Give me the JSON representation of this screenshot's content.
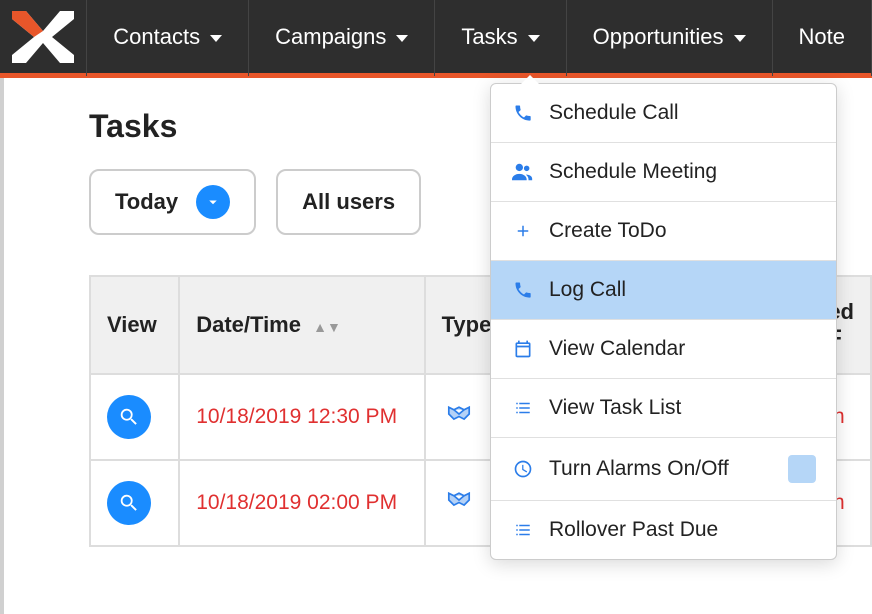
{
  "nav": {
    "contacts": "Contacts",
    "campaigns": "Campaigns",
    "tasks": "Tasks",
    "opportunities": "Opportunities",
    "notes": "Note"
  },
  "page": {
    "title": "Tasks"
  },
  "filters": {
    "today": "Today",
    "all_users": "All users"
  },
  "dropdown": {
    "schedule_call": "Schedule Call",
    "schedule_meeting": "Schedule Meeting",
    "create_todo": "Create ToDo",
    "log_call": "Log Call",
    "view_calendar": "View Calendar",
    "view_task_list": "View Task List",
    "turn_alarms": "Turn Alarms On/Off",
    "rollover": "Rollover Past Due"
  },
  "table": {
    "headers": {
      "view": "View",
      "datetime": "Date/Time",
      "type": "Type",
      "partial": "ed F"
    },
    "rows": [
      {
        "datetime": "10/18/2019 12:30 PM",
        "partial": "in"
      },
      {
        "datetime": "10/18/2019 02:00 PM",
        "partial": "in"
      }
    ]
  }
}
